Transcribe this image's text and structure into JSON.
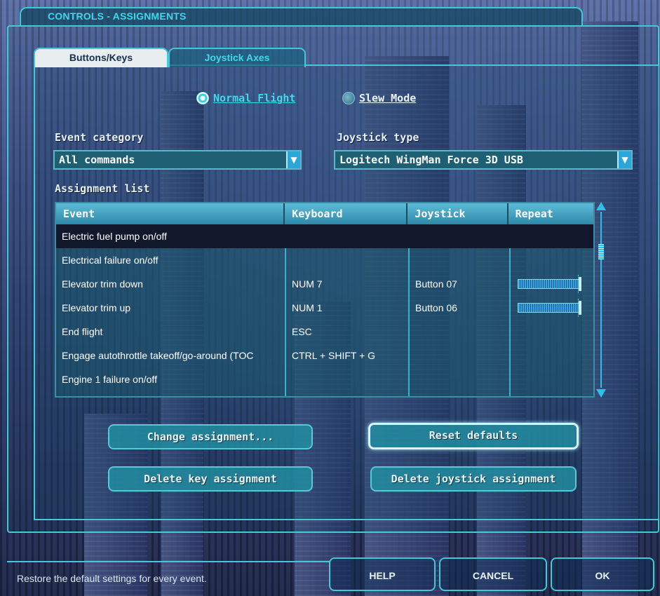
{
  "window": {
    "title": "CONTROLS - ASSIGNMENTS"
  },
  "tabs": [
    {
      "label": "Buttons/Keys",
      "active": true
    },
    {
      "label": "Joystick Axes",
      "active": false
    }
  ],
  "mode": {
    "normal_flight": {
      "label": "Normal Flight",
      "selected": true
    },
    "slew_mode": {
      "label": "Slew Mode",
      "selected": false
    }
  },
  "event_category": {
    "label": "Event category",
    "value": "All commands"
  },
  "joystick_type": {
    "label": "Joystick type",
    "value": "Logitech WingMan Force 3D USB"
  },
  "assignment_list": {
    "label": "Assignment list",
    "columns": [
      "Event",
      "Keyboard",
      "Joystick",
      "Repeat"
    ],
    "rows": [
      {
        "event": "Electric fuel pump on/off",
        "keyboard": "",
        "joystick": "",
        "repeat": null,
        "selected": true
      },
      {
        "event": "Electrical failure on/off",
        "keyboard": "",
        "joystick": "",
        "repeat": null
      },
      {
        "event": "Elevator trim down",
        "keyboard": "NUM 7",
        "joystick": "Button 07",
        "repeat": 1.0
      },
      {
        "event": "Elevator trim up",
        "keyboard": "NUM 1",
        "joystick": "Button 06",
        "repeat": 1.0
      },
      {
        "event": "End flight",
        "keyboard": "ESC",
        "joystick": "",
        "repeat": null
      },
      {
        "event": "Engage autothrottle takeoff/go-around (TOC",
        "keyboard": "CTRL + SHIFT + G",
        "joystick": "",
        "repeat": null
      },
      {
        "event": "Engine 1 failure on/off",
        "keyboard": "",
        "joystick": "",
        "repeat": null
      }
    ]
  },
  "buttons": {
    "change_assignment": "Change assignment...",
    "reset_defaults": "Reset defaults",
    "delete_key_assignment": "Delete key assignment",
    "delete_joystick_assignment": "Delete joystick assignment"
  },
  "status_text": "Restore the default settings for every event.",
  "footer": {
    "help": "HELP",
    "cancel": "CANCEL",
    "ok": "OK"
  },
  "colors": {
    "accent": "#43c8d6",
    "header": "#2e88a8",
    "selected_row": "#12182c"
  }
}
